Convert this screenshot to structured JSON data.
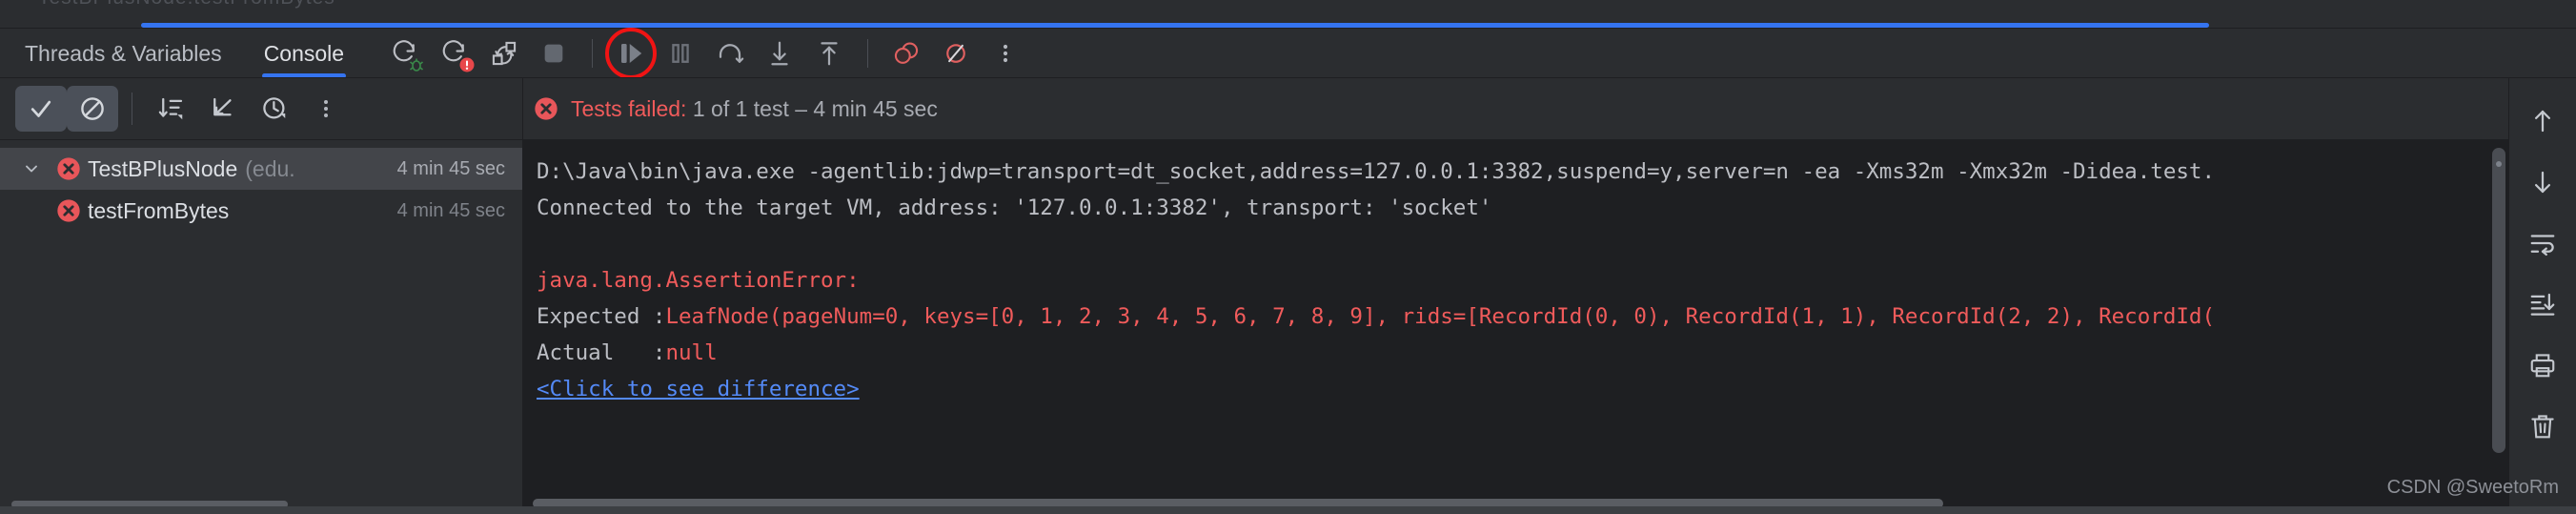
{
  "window": {
    "ghost_title_prefix": "...",
    "ghost_title": "TestBPlusNode.testFromBytes"
  },
  "tabs": [
    {
      "id": "threads-variables",
      "label": "Threads & Variables",
      "active": false
    },
    {
      "id": "console",
      "label": "Console",
      "active": true
    }
  ],
  "debug_toolbar": {
    "icons": [
      {
        "name": "rerun-debug-icon",
        "title": "Rerun"
      },
      {
        "name": "rerun-failed-tests-icon",
        "title": "Rerun Failed Tests"
      },
      {
        "name": "toggle-auto-test-icon",
        "title": "Toggle auto-test"
      },
      {
        "name": "stop-icon",
        "title": "Stop"
      },
      {
        "name": "resume-program-icon",
        "title": "Resume Program",
        "highlighted": true
      },
      {
        "name": "pause-program-icon",
        "title": "Pause Program"
      },
      {
        "name": "step-over-icon",
        "title": "Step Over"
      },
      {
        "name": "step-into-icon",
        "title": "Step Into"
      },
      {
        "name": "step-out-icon",
        "title": "Step Out"
      },
      {
        "name": "view-breakpoints-icon",
        "title": "View Breakpoints"
      },
      {
        "name": "mute-breakpoints-icon",
        "title": "Mute Breakpoints"
      },
      {
        "name": "more-options-icon",
        "title": "More"
      }
    ]
  },
  "test_toolbar": {
    "icons": [
      {
        "name": "show-passed-icon",
        "title": "Show Passed",
        "selected": true
      },
      {
        "name": "show-ignored-icon",
        "title": "Show Ignored",
        "selected": true
      },
      {
        "name": "sort-by-duration-icon",
        "title": "Sort by Duration"
      },
      {
        "name": "expand-collapse-icon",
        "title": "Expand / Collapse"
      },
      {
        "name": "test-history-icon",
        "title": "Test History"
      },
      {
        "name": "more-options-icon",
        "title": "More"
      }
    ]
  },
  "test_tree": {
    "rows": [
      {
        "name": "TestBPlusNode",
        "package": "(edu.",
        "duration": "4 min 45 sec",
        "status": "failed",
        "selected": true,
        "expanded": true,
        "child": false
      },
      {
        "name": "testFromBytes",
        "package": "",
        "duration": "4 min 45 sec",
        "status": "failed",
        "selected": false,
        "expanded": false,
        "child": true
      }
    ]
  },
  "status": {
    "icon": "test-failed-icon",
    "title": "Tests failed:",
    "detail": " 1 of 1 test – 4 min 45 sec"
  },
  "console": {
    "lines": [
      {
        "type": "plain",
        "text": "D:\\Java\\bin\\java.exe -agentlib:jdwp=transport=dt_socket,address=127.0.0.1:3382,suspend=y,server=n -ea -Xms32m -Xmx32m -Didea.test."
      },
      {
        "type": "plain",
        "text": "Connected to the target VM, address: '127.0.0.1:3382', transport: 'socket'"
      },
      {
        "type": "blank",
        "text": ""
      },
      {
        "type": "error",
        "text": "java.lang.AssertionError:"
      },
      {
        "type": "expected",
        "prefix": "Expected :",
        "text": "LeafNode(pageNum=0, keys=[0, 1, 2, 3, 4, 5, 6, 7, 8, 9], rids=[RecordId(0, 0), RecordId(1, 1), RecordId(2, 2), RecordId("
      },
      {
        "type": "actual",
        "prefix": "Actual   :",
        "text": "null"
      },
      {
        "type": "link",
        "text": "<Click to see difference>"
      }
    ]
  },
  "gutter": {
    "icons": [
      {
        "name": "scroll-up-icon",
        "title": "Up"
      },
      {
        "name": "scroll-down-icon",
        "title": "Down"
      },
      {
        "name": "soft-wrap-icon",
        "title": "Soft-Wrap"
      },
      {
        "name": "scroll-to-end-icon",
        "title": "Scroll to End"
      },
      {
        "name": "print-icon",
        "title": "Print"
      },
      {
        "name": "clear-all-icon",
        "title": "Clear All"
      }
    ]
  },
  "watermark": "CSDN @SweetoRm",
  "colors": {
    "accent_blue": "#3574f0",
    "error_red": "#f05b5b",
    "highlight_red": "#f01414",
    "link_blue": "#548af7",
    "panel_bg": "#2b2d30",
    "console_bg": "#1e1f22"
  }
}
